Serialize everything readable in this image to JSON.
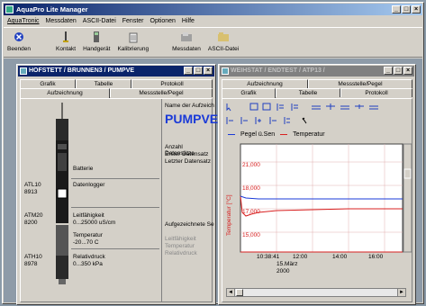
{
  "app": {
    "title": "AquaPro Lite Manager"
  },
  "menu": [
    "AquaTronic",
    "Messdaten",
    "ASCII-Datei",
    "Fenster",
    "Optionen",
    "Hilfe"
  ],
  "toolbar": [
    {
      "label": "Beenden",
      "icon": "exit-icon"
    },
    {
      "label": "Kontakt",
      "icon": "contact-icon"
    },
    {
      "label": "Handgerät",
      "icon": "handheld-icon"
    },
    {
      "label": "Kalibrierung",
      "icon": "calibration-icon"
    },
    {
      "label": "Messdaten",
      "icon": "measurement-data-icon"
    },
    {
      "label": "ASCII-Datei",
      "icon": "ascii-file-icon"
    }
  ],
  "left": {
    "title": "HOFSTETT / BRUNNEN3 / PUMPVE",
    "tabs_row1": [
      "Grafik",
      "Tabelle",
      "Protokoll"
    ],
    "tabs_row2": [
      "Aufzeichnung",
      "Messstelle/Pegel"
    ],
    "devices": [
      {
        "label": "Batterie"
      },
      {
        "code": "ATL10",
        "serial": "8913",
        "label": "Datenlogger"
      },
      {
        "code": "ATM20",
        "serial": "8200",
        "label": "Leitfähigkeit",
        "range": "0...25000 uS/cm"
      },
      {
        "label": "Temperatur",
        "range": "-20...70 C"
      },
      {
        "code": "ATH10",
        "serial": "8978",
        "label": "Relativdruck",
        "range": "0...350 kPa"
      }
    ],
    "info_label": "Name der Aufzeich",
    "info_value": "PUMPVE",
    "fields": [
      "Anzahl Datensätze",
      "Erster Datensatz",
      "Letzter Datensatz"
    ],
    "recorded_label": "Aufgezeichnete Se",
    "recorded_items": [
      "Leitfähigkeit",
      "Temperatur",
      "Relativdruck"
    ]
  },
  "right": {
    "title": "WEIHSTAT / ENDTEST / ATP13 /",
    "tabs_row1": [
      "Aufzeichnung",
      "Messstelle/Pegel"
    ],
    "tabs_row2": [
      "Grafik",
      "Tabelle",
      "Protokoll"
    ],
    "legend": [
      {
        "name": "Pegel ü.Sen",
        "color": "#1a3ad8"
      },
      {
        "name": "Temperatur",
        "color": "#d82020"
      }
    ],
    "y_axis_label": "Temperatur [°C]",
    "y_ticks": [
      "21,000",
      "18,000",
      "17,000",
      "15,000"
    ],
    "x_ticks": [
      "10:38:41",
      "12:00",
      "14:00",
      "16:00"
    ],
    "x_date": "15.März",
    "x_year": "2000"
  },
  "colors": {
    "blue": "#1a3ad8",
    "red": "#d82020",
    "mdi_bg": "#8e9ba8"
  }
}
